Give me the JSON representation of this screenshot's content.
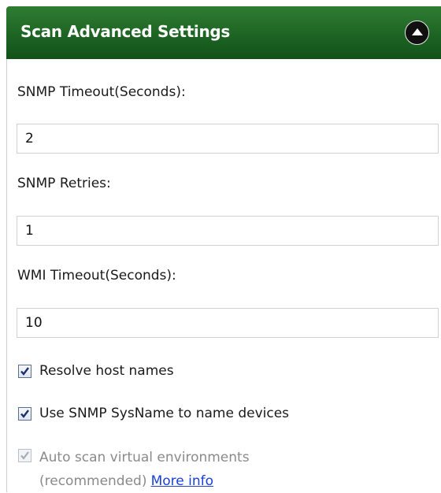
{
  "header": {
    "title": "Scan Advanced Settings",
    "collapse_icon": "chevron-up-icon"
  },
  "fields": {
    "snmp_timeout_label": "SNMP Timeout(Seconds):",
    "snmp_timeout_value": "2",
    "snmp_retries_label": "SNMP Retries:",
    "snmp_retries_value": "1",
    "wmi_timeout_label": "WMI Timeout(Seconds):",
    "wmi_timeout_value": "10"
  },
  "options": {
    "resolve_host_names": {
      "label": "Resolve host names",
      "checked": true,
      "enabled": true
    },
    "use_sysname": {
      "label": "Use SNMP SysName to name devices",
      "checked": true,
      "enabled": true
    },
    "auto_scan_virtual": {
      "label_line1": "Auto scan virtual environments",
      "label_line2": "(recommended)",
      "link_text": "More info",
      "checked": true,
      "enabled": false
    }
  },
  "colors": {
    "header_green": "#1d6423",
    "link_blue": "#1a40d6",
    "disabled_text": "#8a8a8a"
  }
}
